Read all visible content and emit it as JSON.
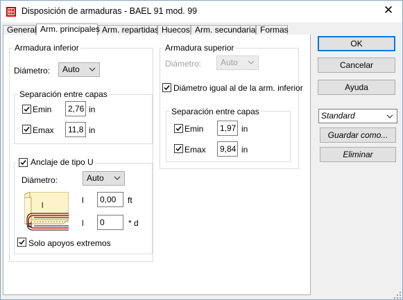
{
  "window": {
    "title": "Disposición de armaduras - BAEL 91 mod. 99",
    "close_glyph": "✕"
  },
  "tabs": [
    {
      "label": "General"
    },
    {
      "label": "Arm. principales"
    },
    {
      "label": "Arm. repartidas"
    },
    {
      "label": "Huecos"
    },
    {
      "label": "Arm. secundarias"
    },
    {
      "label": "Formas"
    }
  ],
  "inferior": {
    "title": "Armadura inferior",
    "diametro_label": "Diámetro:",
    "diametro_value": "Auto",
    "separacion": {
      "title": "Separación entre capas",
      "emin_label": "Emin",
      "emin_checked": true,
      "emin_value": "2,76",
      "emin_unit": "in",
      "emax_label": "Emax",
      "emax_checked": true,
      "emax_value": "11,8",
      "emax_unit": "in"
    }
  },
  "anclaje": {
    "label": "Anclaje de tipo U",
    "checked": true,
    "diametro_label": "Diámetro:",
    "diametro_value": "Auto",
    "l1_label": "l",
    "l1_value": "0,00",
    "l1_unit": "ft",
    "l2_label": "l",
    "l2_value": "0",
    "l2_unit": "* d",
    "diagram_l": "l",
    "diagram_d": "d",
    "solo_label": "Solo apoyos extremos",
    "solo_checked": true
  },
  "superior": {
    "title": "Armadura superior",
    "diametro_label": "Diámetro:",
    "diametro_value": "Auto",
    "igual_label": "Diámetro igual al de la arm. inferior",
    "igual_checked": true,
    "separacion": {
      "title": "Separación entre capas",
      "emin_label": "Emin",
      "emin_checked": true,
      "emin_value": "1,97",
      "emin_unit": "in",
      "emax_label": "Emax",
      "emax_checked": true,
      "emax_value": "9,84",
      "emax_unit": "in"
    }
  },
  "buttons": {
    "ok": "OK",
    "cancel": "Cancelar",
    "help": "Ayuda",
    "standard": "Standard",
    "save_as": "Guardar como...",
    "delete": "Eliminar"
  },
  "colors": {
    "accent": "#0078d7",
    "dialog_bg": "#f0f0f0"
  }
}
